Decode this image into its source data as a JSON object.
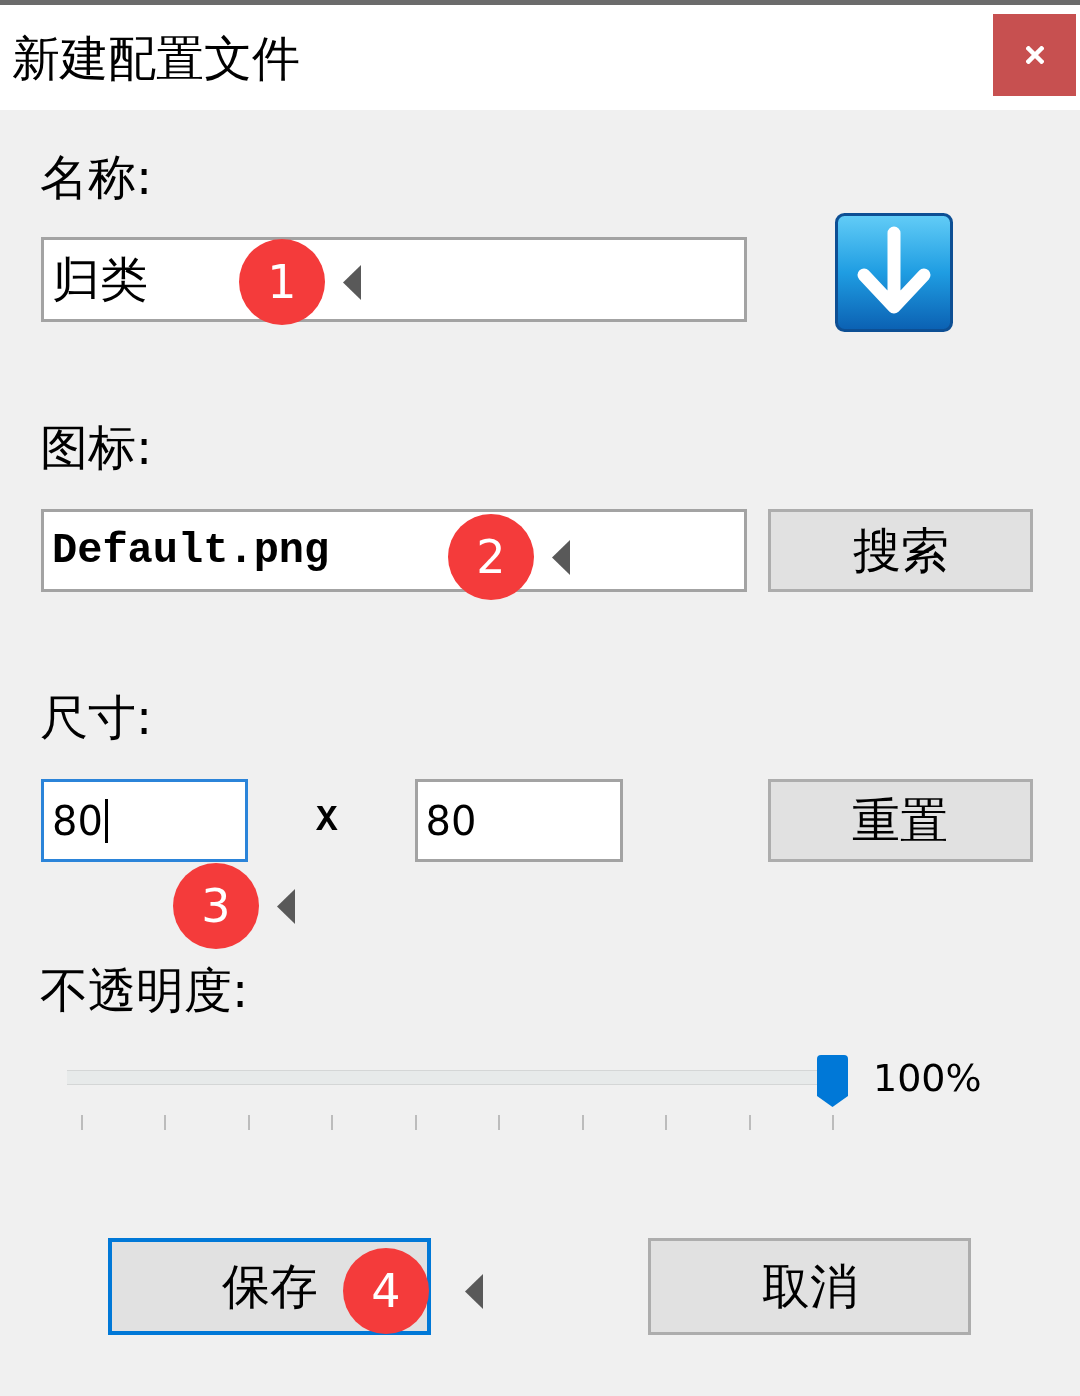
{
  "window": {
    "title": "新建配置文件"
  },
  "name": {
    "label": "名称:",
    "value": "归类",
    "marker": "1"
  },
  "icon": {
    "label": "图标:",
    "value": "Default.png",
    "marker": "2",
    "button": "搜索"
  },
  "size": {
    "label": "尺寸:",
    "width": {
      "value": "80",
      "focused": true
    },
    "separator": "X",
    "height": {
      "value": "80",
      "focused": false
    },
    "marker": "3",
    "button": "重置"
  },
  "opacity": {
    "label": "不透明度:",
    "level": 1,
    "reading": "100%"
  },
  "buttons": [
    {
      "label": "保存",
      "default": true,
      "marker": "4"
    },
    {
      "label": "取消",
      "default": false
    }
  ]
}
